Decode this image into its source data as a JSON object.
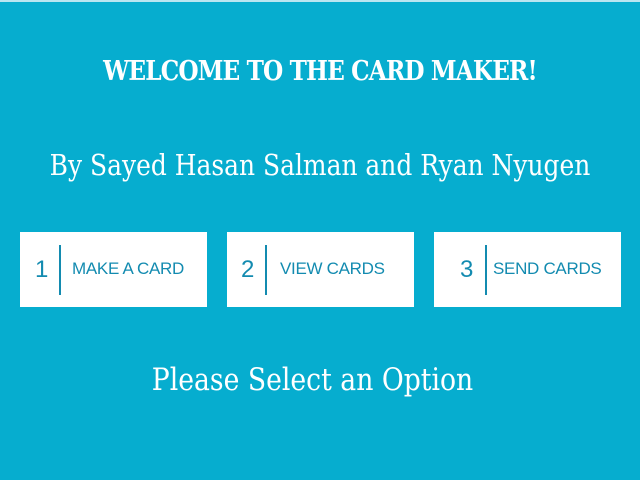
{
  "header": {
    "title": "WELCOME TO THE CARD MAKER!",
    "authors": "By Sayed Hasan Salman and Ryan Nyugen"
  },
  "options": [
    {
      "number": "1",
      "label": "MAKE A CARD"
    },
    {
      "number": "2",
      "label": "VIEW CARDS"
    },
    {
      "number": "3",
      "label": "SEND CARDS"
    }
  ],
  "prompt": "Please Select an Option",
  "colors": {
    "background": "#06adcf",
    "button_background": "#ffffff",
    "button_text": "#138bb0",
    "heading_text": "#ffffff"
  }
}
